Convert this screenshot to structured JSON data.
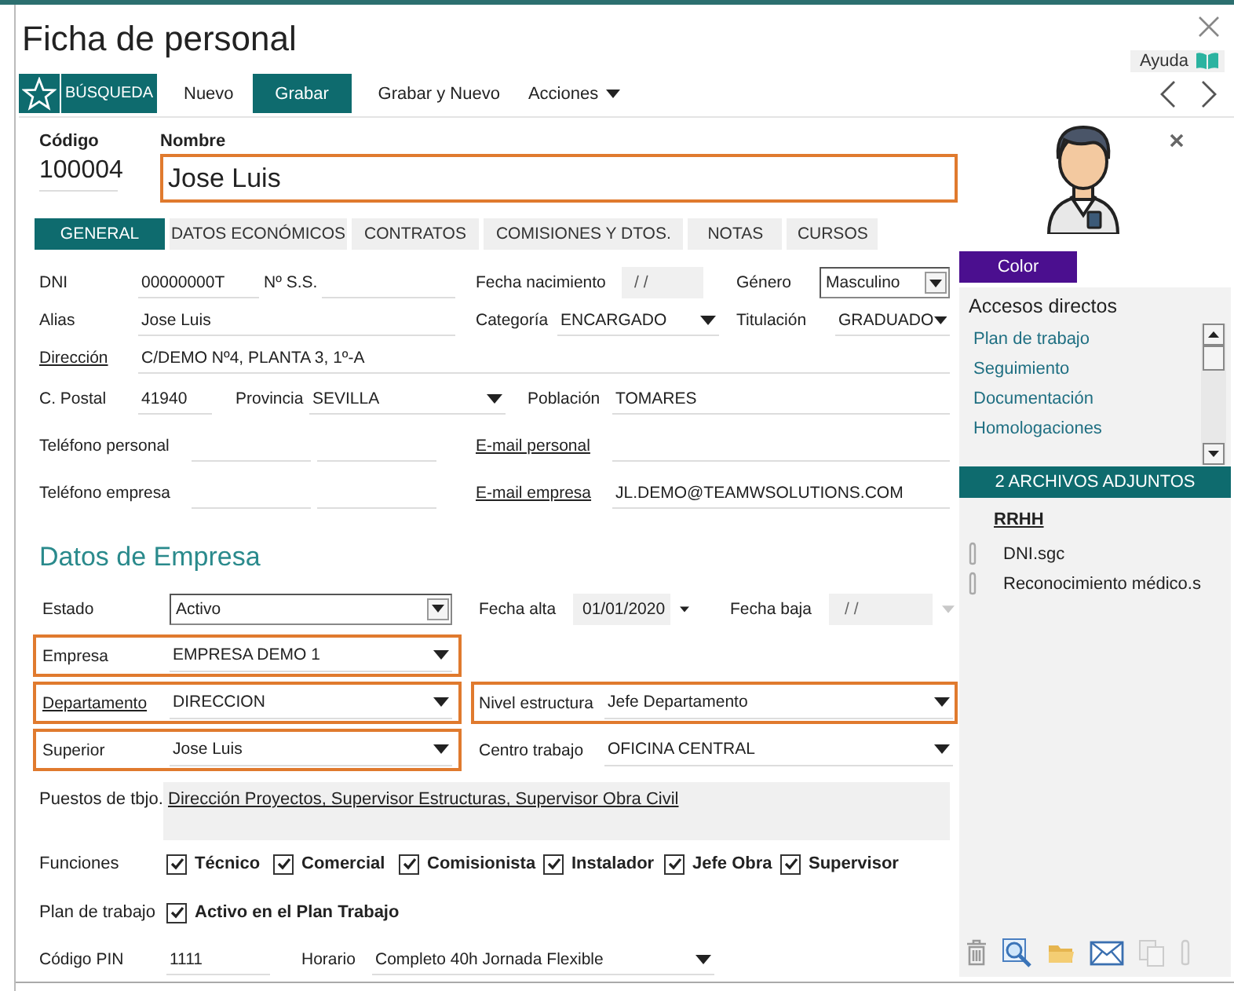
{
  "window": {
    "title": "Ficha de personal",
    "help": "Ayuda"
  },
  "toolbar": [
    {
      "label": "BÚSQUEDA",
      "kind": "search"
    },
    {
      "label": "Nuevo",
      "kind": "plain"
    },
    {
      "label": "Grabar",
      "kind": "primary"
    },
    {
      "label": "Grabar y Nuevo",
      "kind": "plain"
    },
    {
      "label": "Acciones",
      "kind": "menu"
    }
  ],
  "header": {
    "code_label": "Código",
    "code": "100004",
    "name_label": "Nombre",
    "name": "Jose Luis",
    "name_highlighted": true
  },
  "tabs": [
    {
      "label": "GENERAL",
      "selected": true
    },
    {
      "label": "DATOS ECONÓMICOS",
      "selected": false
    },
    {
      "label": "CONTRATOS",
      "selected": false
    },
    {
      "label": "COMISIONES Y DTOS.",
      "selected": false
    },
    {
      "label": "NOTAS",
      "selected": false
    },
    {
      "label": "CURSOS",
      "selected": false
    }
  ],
  "personal_rows": [
    {
      "cells": [
        {
          "kind": "label",
          "text": "DNI"
        },
        {
          "kind": "input",
          "value": "00000000T"
        },
        {
          "kind": "label",
          "text": "Nº S.S."
        },
        {
          "kind": "input"
        },
        {
          "kind": "label",
          "text": "Fecha nacimiento"
        },
        {
          "kind": "date",
          "value": "/ /"
        },
        {
          "kind": "label",
          "text": "Género"
        },
        {
          "kind": "combo",
          "value": "Masculino"
        }
      ]
    },
    {
      "cells": [
        {
          "kind": "label",
          "text": "Alias"
        },
        {
          "kind": "input",
          "value": "Jose Luis"
        },
        {
          "kind": "label",
          "text": "Categoría"
        },
        {
          "kind": "select",
          "value": "ENCARGADO"
        },
        {
          "kind": "label",
          "text": "Titulación"
        },
        {
          "kind": "select",
          "value": "GRADUADO"
        }
      ]
    },
    {
      "cells": [
        {
          "kind": "link",
          "text": "Dirección"
        },
        {
          "kind": "input",
          "value": "C/DEMO Nº4, PLANTA 3, 1º-A"
        }
      ]
    },
    {
      "cells": [
        {
          "kind": "label",
          "text": "C. Postal"
        },
        {
          "kind": "input",
          "value": "41940"
        },
        {
          "kind": "label",
          "text": "Provincia"
        },
        {
          "kind": "select",
          "value": "SEVILLA"
        },
        {
          "kind": "label",
          "text": "Población"
        },
        {
          "kind": "input",
          "value": "TOMARES"
        }
      ]
    },
    {
      "cells": [
        {
          "kind": "label",
          "text": "Teléfono personal"
        },
        {
          "kind": "input"
        },
        {
          "kind": "input"
        },
        {
          "kind": "link",
          "text": "E-mail personal"
        },
        {
          "kind": "input"
        }
      ]
    },
    {
      "cells": [
        {
          "kind": "label",
          "text": "Teléfono empresa"
        },
        {
          "kind": "input"
        },
        {
          "kind": "input"
        },
        {
          "kind": "link",
          "text": "E-mail empresa"
        },
        {
          "kind": "input",
          "value": "JL.DEMO@TEAMWSOLUTIONS.COM"
        }
      ]
    }
  ],
  "company_title": "Datos de Empresa",
  "company_rows": [
    {
      "groups": [
        {
          "highlighted": false,
          "cells": [
            {
              "kind": "label",
              "text": "Estado"
            },
            {
              "kind": "combo",
              "value": "Activo"
            }
          ]
        },
        {
          "highlighted": false,
          "cells": [
            {
              "kind": "label",
              "text": "Fecha alta"
            },
            {
              "kind": "datepick",
              "value": "01/01/2020",
              "disabled": false
            }
          ]
        },
        {
          "highlighted": false,
          "cells": [
            {
              "kind": "label",
              "text": "Fecha baja"
            },
            {
              "kind": "datepick",
              "value": "/ /",
              "disabled": true
            }
          ]
        }
      ]
    },
    {
      "groups": [
        {
          "highlighted": true,
          "cells": [
            {
              "kind": "label",
              "text": "Empresa"
            },
            {
              "kind": "select",
              "value": "EMPRESA DEMO 1"
            }
          ]
        }
      ]
    },
    {
      "groups": [
        {
          "highlighted": true,
          "cells": [
            {
              "kind": "link",
              "text": "Departamento"
            },
            {
              "kind": "select",
              "value": "DIRECCION"
            }
          ]
        },
        {
          "highlighted": true,
          "cells": [
            {
              "kind": "label",
              "text": "Nivel estructura"
            },
            {
              "kind": "select",
              "value": "Jefe Departamento"
            }
          ]
        }
      ]
    },
    {
      "groups": [
        {
          "highlighted": true,
          "cells": [
            {
              "kind": "label",
              "text": "Superior"
            },
            {
              "kind": "select",
              "value": "Jose Luis"
            }
          ]
        },
        {
          "highlighted": false,
          "cells": [
            {
              "kind": "label",
              "text": "Centro trabajo"
            },
            {
              "kind": "select",
              "value": "OFICINA CENTRAL"
            }
          ]
        }
      ]
    }
  ],
  "work_positions": {
    "label": "Puestos de tbjo.",
    "value": "Dirección Proyectos, Supervisor Estructuras, Supervisor Obra Civil"
  },
  "functions": {
    "label": "Funciones",
    "options": [
      {
        "label": "Técnico",
        "checked": true
      },
      {
        "label": "Comercial",
        "checked": true
      },
      {
        "label": "Comisionista",
        "checked": true
      },
      {
        "label": "Instalador",
        "checked": true
      },
      {
        "label": "Jefe Obra",
        "checked": true
      },
      {
        "label": "Supervisor",
        "checked": true
      }
    ]
  },
  "work_plan": {
    "label": "Plan de trabajo",
    "option": {
      "label": "Activo en el Plan Trabajo",
      "checked": true
    }
  },
  "pin_row": {
    "cells": [
      {
        "kind": "label",
        "text": "Código PIN"
      },
      {
        "kind": "input",
        "value": "1111"
      },
      {
        "kind": "label",
        "text": "Horario"
      },
      {
        "kind": "select",
        "value": "Completo 40h Jornada Flexible"
      }
    ]
  },
  "side": {
    "color_button": "Color",
    "shortcuts_title": "Accesos directos",
    "shortcuts": [
      "Plan de trabajo",
      "Seguimiento",
      "Documentación",
      "Homologaciones"
    ],
    "attachments_title": "2 ARCHIVOS ADJUNTOS",
    "folder": "RRHH",
    "files": [
      "DNI.sgc",
      "Reconocimiento médico.s"
    ]
  }
}
